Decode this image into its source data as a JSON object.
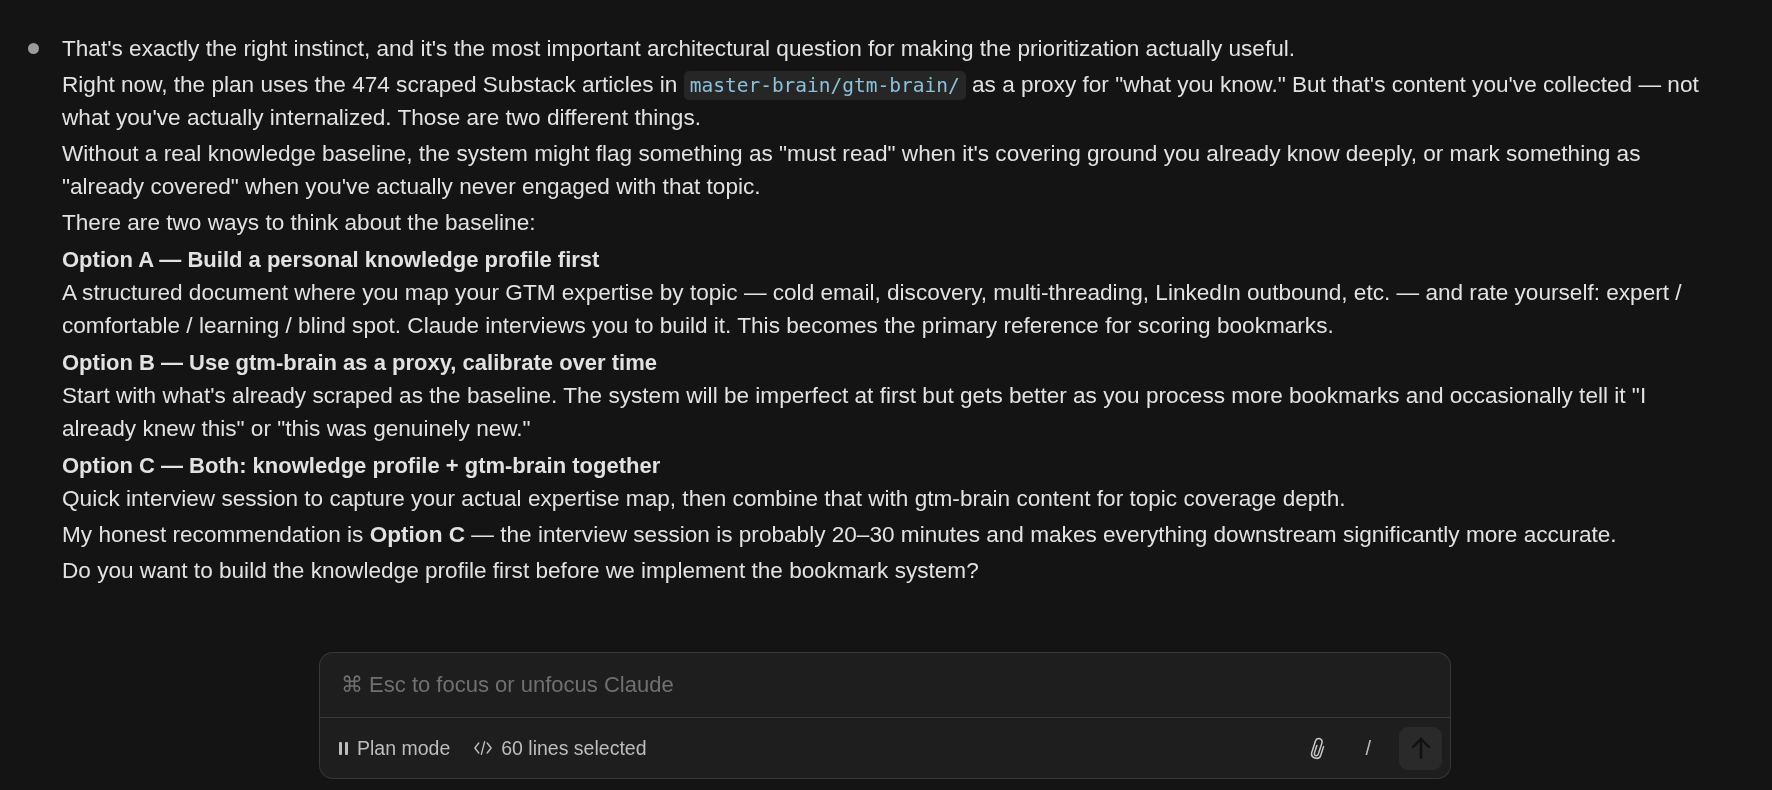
{
  "message": {
    "paragraphs": [
      {
        "kind": "text",
        "text": "That's exactly the right instinct, and it's the most important architectural question for making the prioritization actually useful."
      },
      {
        "kind": "mixed",
        "parts": [
          {
            "kind": "text",
            "text": "Right now, the plan uses the 474 scraped Substack articles in "
          },
          {
            "kind": "code",
            "text": "master-brain/gtm-brain/"
          },
          {
            "kind": "text",
            "text": " as a proxy for \"what you know.\" But that's content you've collected — not what you've actually internalized. Those are two different things."
          }
        ]
      },
      {
        "kind": "text",
        "text": "Without a real knowledge baseline, the system might flag something as \"must read\" when it's covering ground you already know deeply, or mark something as \"already covered\" when you've actually never engaged with that topic."
      },
      {
        "kind": "text",
        "text": "There are two ways to think about the baseline:"
      },
      {
        "kind": "heading",
        "text": "Option A — Build a personal knowledge profile first"
      },
      {
        "kind": "text",
        "text": "A structured document where you map your GTM expertise by topic — cold email, discovery, multi-threading, LinkedIn outbound, etc. — and rate yourself: expert / comfortable / learning / blind spot. Claude interviews you to build it. This becomes the primary reference for scoring bookmarks."
      },
      {
        "kind": "heading",
        "text": "Option B — Use gtm-brain as a proxy, calibrate over time"
      },
      {
        "kind": "text",
        "text": "Start with what's already scraped as the baseline. The system will be imperfect at first but gets better as you process more bookmarks and occasionally tell it \"I already knew this\" or \"this was genuinely new.\""
      },
      {
        "kind": "heading",
        "text": "Option C — Both: knowledge profile + gtm-brain together"
      },
      {
        "kind": "text",
        "text": "Quick interview session to capture your actual expertise map, then combine that with gtm-brain content for topic coverage depth."
      },
      {
        "kind": "text",
        "text": "My honest recommendation is **Option C** — the interview session is probably 20–30 minutes and makes everything downstream significantly more accurate."
      },
      {
        "kind": "text",
        "text": "Do you want to build the knowledge profile first before we implement the bookmark system?"
      }
    ]
  },
  "composer": {
    "input": {
      "placeholder": "⌘ Esc to focus or unfocus Claude"
    },
    "mode_button": {
      "label": "Plan mode"
    },
    "selection_button": {
      "label": "60 lines selected"
    },
    "slash_button": {
      "label": "/"
    },
    "send_button": {
      "disabled": true
    }
  }
}
